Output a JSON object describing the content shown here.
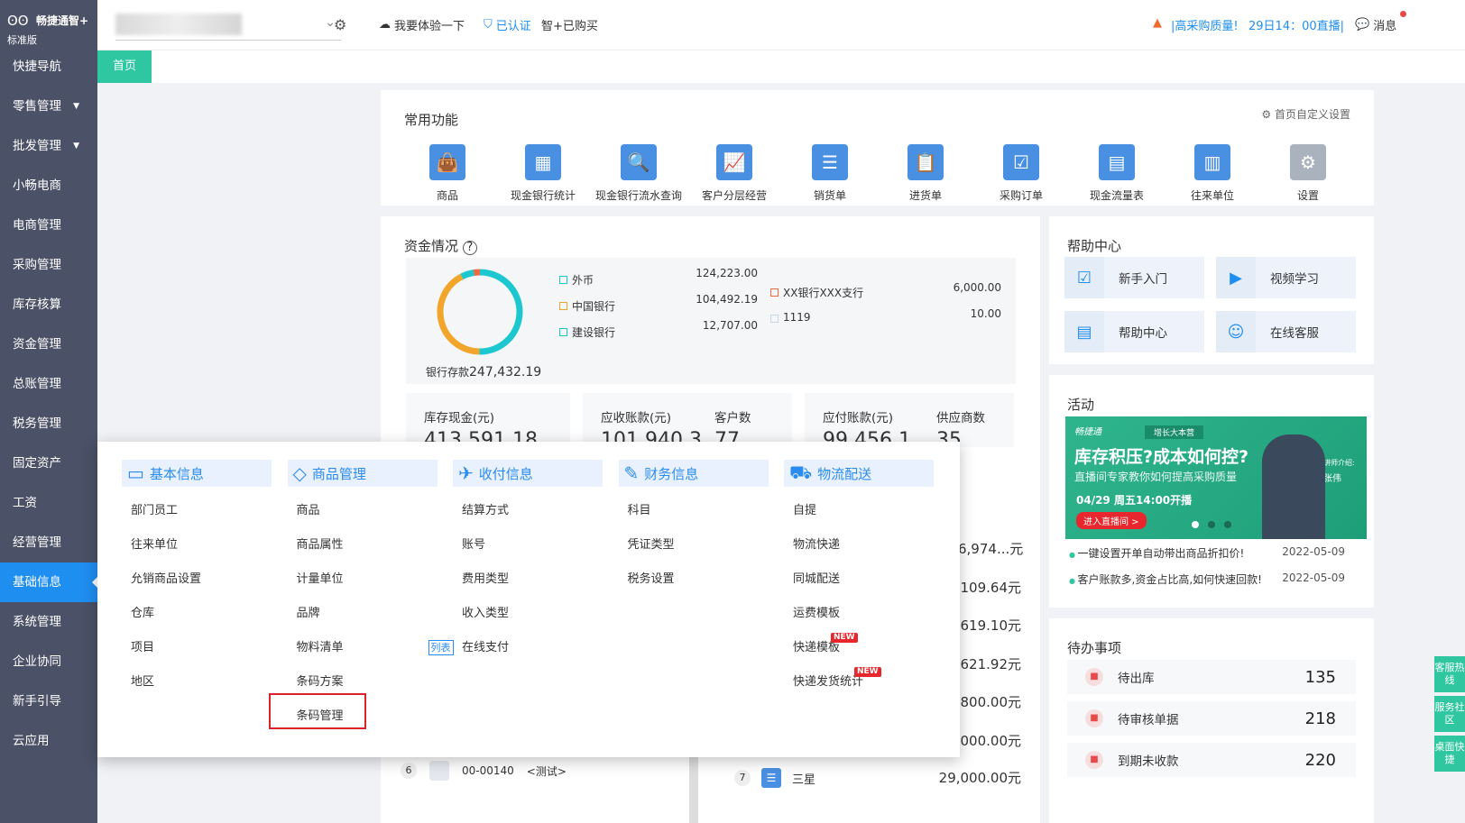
{
  "app": {
    "brand": "畅捷通智+",
    "edition": "标准版"
  },
  "sidebar": {
    "items": [
      {
        "label": "快捷导航"
      },
      {
        "label": "零售管理",
        "caret": "▼"
      },
      {
        "label": "批发管理",
        "caret": "▼"
      },
      {
        "label": "小畅电商"
      },
      {
        "label": "电商管理"
      },
      {
        "label": "采购管理"
      },
      {
        "label": "库存核算"
      },
      {
        "label": "资金管理"
      },
      {
        "label": "总账管理"
      },
      {
        "label": "税务管理"
      },
      {
        "label": "固定资产"
      },
      {
        "label": "工资"
      },
      {
        "label": "经营管理"
      },
      {
        "label": "基础信息"
      },
      {
        "label": "系统管理"
      },
      {
        "label": "企业协同"
      },
      {
        "label": "新手引导"
      },
      {
        "label": "云应用"
      }
    ]
  },
  "topbar": {
    "try": "我要体验一下",
    "verified": "已认证",
    "bought": "智+已购买",
    "promo": "|高采购质量!",
    "live": "29日14：00直播|",
    "messages": "消息"
  },
  "tabs": {
    "home": "首页"
  },
  "common": {
    "title": "常用功能",
    "customize": "首页自定义设置",
    "items": [
      {
        "label": "商品",
        "icon": "bag-icon"
      },
      {
        "label": "现金银行统计",
        "icon": "cash-stats-icon"
      },
      {
        "label": "现金银行流水查询",
        "icon": "flow-query-icon"
      },
      {
        "label": "客户分层经营",
        "icon": "chart-icon"
      },
      {
        "label": "销货单",
        "icon": "doc-icon"
      },
      {
        "label": "进货单",
        "icon": "clipboard-icon"
      },
      {
        "label": "采购订单",
        "icon": "check-clipboard-icon"
      },
      {
        "label": "现金流量表",
        "icon": "report-icon"
      },
      {
        "label": "往来单位",
        "icon": "building-icon"
      },
      {
        "label": "设置",
        "icon": "gear-icon"
      }
    ]
  },
  "funds": {
    "title": "资金情况",
    "total_label": "银行存款",
    "total": "247,432.19",
    "legend": [
      {
        "label": "外币",
        "value": "124,223.00",
        "color": "#1cc7d0"
      },
      {
        "label": "中国银行",
        "value": "104,492.19",
        "color": "#f2a52b"
      },
      {
        "label": "建设银行",
        "value": "12,707.00",
        "color": "#1cc7d0"
      }
    ],
    "legend2": [
      {
        "label": "XX银行XXX支行",
        "value": "6,000.00",
        "color": "#ee6a3c"
      },
      {
        "label": "1119",
        "value": "10.00",
        "color": "#c9d6e8"
      }
    ],
    "donut": [
      {
        "label": "外币",
        "value": 124223.0,
        "color": "#1cc7d0"
      },
      {
        "label": "中国银行",
        "value": 104492.19,
        "color": "#f2a52b"
      },
      {
        "label": "建设银行",
        "value": 12707.0,
        "color": "#1cc7d0"
      },
      {
        "label": "XX银行XXX支行",
        "value": 6000.0,
        "color": "#ee6a3c"
      },
      {
        "label": "1119",
        "value": 10.0,
        "color": "#c9d6e8"
      }
    ],
    "stats": [
      {
        "a": "库存现金(元)",
        "b": "",
        "v": "413,591.18"
      },
      {
        "a": "应收账款(元)",
        "b": "客户数",
        "v": "101,940.3",
        "c": "77"
      },
      {
        "a": "应付账款(元)",
        "b": "供应商数",
        "v": "99,456.1",
        "c": "35"
      }
    ]
  },
  "help": {
    "title": "帮助中心",
    "items": [
      {
        "label": "新手入门"
      },
      {
        "label": "视频学习"
      },
      {
        "label": "帮助中心"
      },
      {
        "label": "在线客服"
      }
    ]
  },
  "activity": {
    "title": "活动",
    "banner": {
      "tag": "增长大本营",
      "brand": "畅捷通",
      "headline": "库存积压?成本如何控?",
      "sub": "直播间专家教你如何提高采购质量",
      "date": "04/29 周五14:00开播",
      "cta": "进入直播间 >",
      "speaker_label": "讲师介绍:",
      "speaker": "张伟"
    },
    "news": [
      {
        "text": "一键设置开单自动带出商品折扣价!",
        "date": "2022-05-09"
      },
      {
        "text": "客户账款多,资金占比高,如何快速回款!",
        "date": "2022-05-09"
      }
    ]
  },
  "todo": {
    "title": "待办事项",
    "items": [
      {
        "label": "待出库",
        "value": "135"
      },
      {
        "label": "待审核单据",
        "value": "218"
      },
      {
        "label": "到期未收款",
        "value": "220"
      }
    ]
  },
  "background_rows": {
    "values": [
      "6,974...元",
      "109.64元",
      "619.10元",
      "621.92元",
      "800.00元",
      "000.00元",
      "29,000.00元"
    ],
    "left_row": {
      "idx": "6",
      "code": "00-00140",
      "name": "<测试>"
    },
    "right_row": {
      "idx": "7",
      "name": "三星"
    }
  },
  "menu": {
    "columns": [
      {
        "title": "基本信息",
        "icon": "id-card-icon",
        "items": [
          "部门员工",
          "往来单位",
          "允销商品设置",
          "仓库",
          "项目",
          "地区"
        ]
      },
      {
        "title": "商品管理",
        "icon": "tag-icon",
        "items": [
          "商品",
          "商品属性",
          "计量单位",
          "品牌",
          "物料清单",
          "条码方案",
          "条码管理"
        ],
        "list_badge": "列表"
      },
      {
        "title": "收付信息",
        "icon": "receipt-icon",
        "items": [
          "结算方式",
          "账号",
          "费用类型",
          "收入类型",
          "在线支付"
        ]
      },
      {
        "title": "财务信息",
        "icon": "finance-icon",
        "items": [
          "科目",
          "凭证类型",
          "税务设置"
        ]
      },
      {
        "title": "物流配送",
        "icon": "truck-icon",
        "items": [
          "自提",
          "物流快递",
          "同城配送",
          "运费模板",
          "快递模板",
          "快递发货统计"
        ],
        "new_badge": "NEW"
      }
    ]
  },
  "float": {
    "items": [
      "客服热线",
      "服务社区",
      "桌面快捷"
    ]
  }
}
